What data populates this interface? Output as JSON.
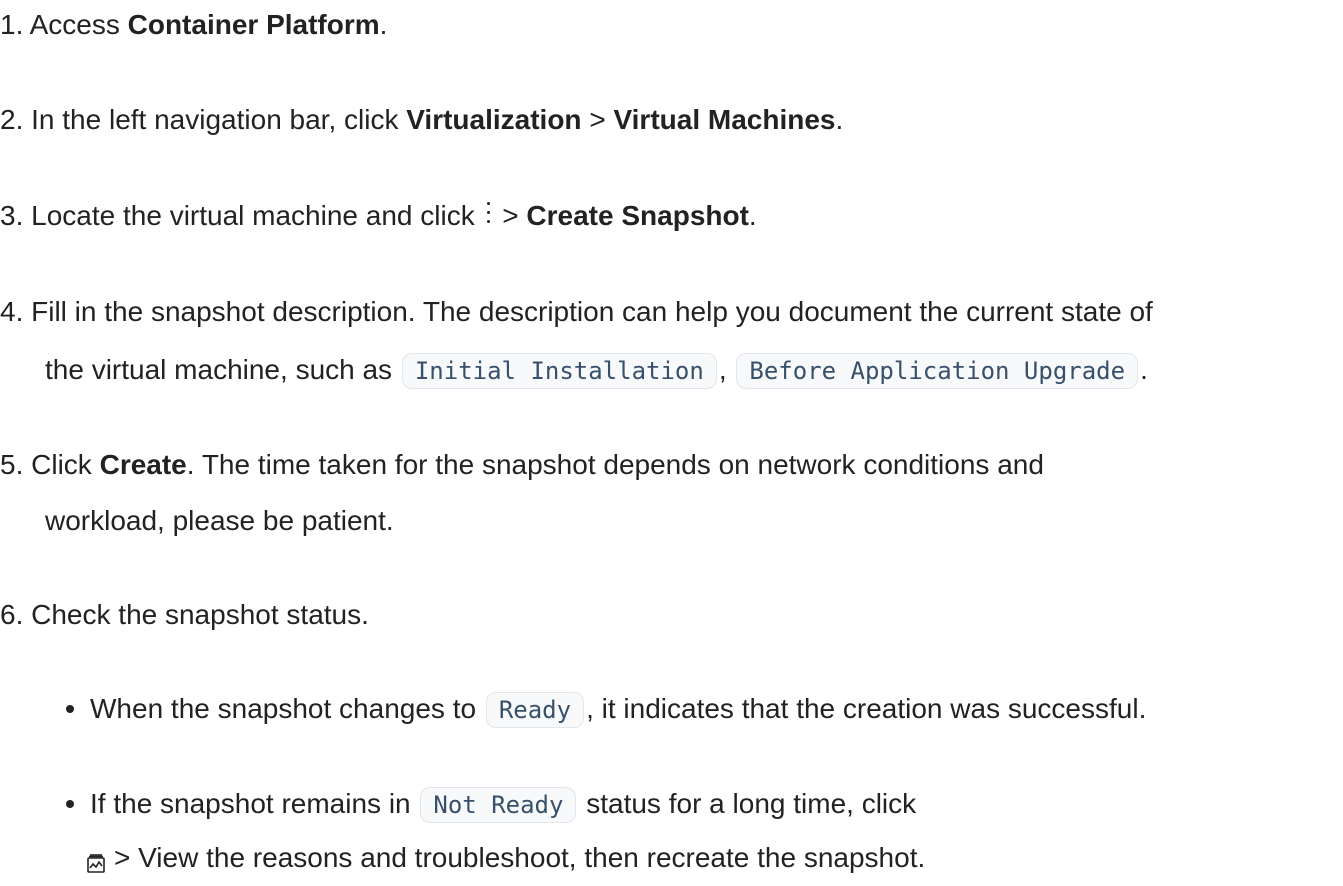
{
  "steps": [
    {
      "num": "1.",
      "pre": "Access ",
      "b1": "Container Platform",
      "post": "."
    },
    {
      "num": "2.",
      "pre": "In the left navigation bar, click ",
      "b1": "Virtualization",
      "mid": " > ",
      "b2": "Virtual Machines",
      "post": "."
    },
    {
      "num": "3.",
      "pre": "Locate the virtual machine and click ",
      "mid": " > ",
      "b1": "Create Snapshot",
      "post": "."
    },
    {
      "num": "4.",
      "line1": "Fill in the snapshot description. The description can help you document the current state of",
      "line2_pre": "the virtual machine, such as ",
      "code1": "Initial Installation",
      "sep": ",",
      "code2": "Before Application Upgrade",
      "post": "."
    },
    {
      "num": "5.",
      "pre": "Click ",
      "b1": "Create",
      "line1_rest": ". The time taken for the snapshot depends on network conditions and",
      "line2": "workload, please be patient."
    },
    {
      "num": "6.",
      "text": "Check the snapshot status."
    }
  ],
  "bullets": [
    {
      "pre": "When the snapshot changes to ",
      "code": "Ready",
      "post": ", it indicates that the creation was successful."
    },
    {
      "pre": "If the snapshot remains in ",
      "code": "Not Ready",
      "post": " status for a long time, click",
      "line2": "> View the reasons and troubleshoot, then recreate the snapshot."
    }
  ],
  "icons": {
    "kebab": "more-vertical-icon",
    "log": "event-log-icon"
  }
}
